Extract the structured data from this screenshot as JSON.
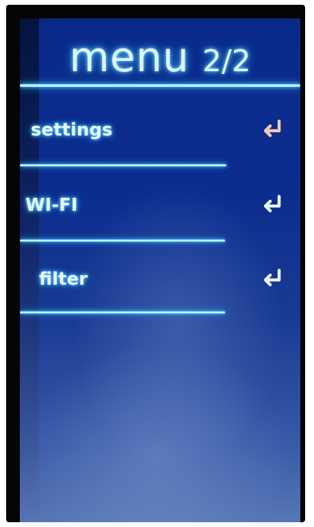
{
  "screen": {
    "title": "menu",
    "page_indicator": "2/2"
  },
  "menu": {
    "items": [
      {
        "label": "settings",
        "icon": "enter-return-icon",
        "icon_color": "#f3c7b8"
      },
      {
        "label": "WI-FI",
        "icon": "enter-return-icon",
        "icon_color": "#e6f7ff"
      },
      {
        "label": "filter",
        "icon": "enter-return-icon",
        "icon_color": "#e6f7ff"
      }
    ]
  },
  "colors": {
    "background": "#0c2d8e",
    "text_glow": "#7fe3ff",
    "rule": "#aef0ff"
  }
}
